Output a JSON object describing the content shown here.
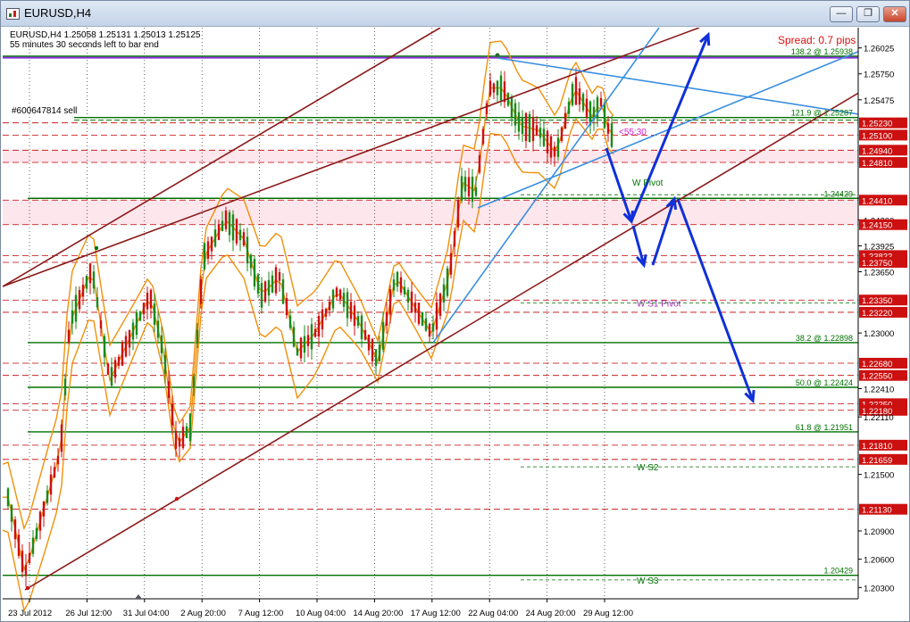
{
  "window": {
    "title": "EURUSD,H4",
    "minimize_icon": "minimize-icon",
    "restore_icon": "restore-icon",
    "close_icon": "close-icon"
  },
  "chart": {
    "symbol_info": "EURUSD,H4  1.25058 1.25131 1.25013 1.25125",
    "bar_timer": "55 minutes 30 seconds left to bar end",
    "order_label": "#600647814 sell",
    "spread": "Spread: 0.7 pips",
    "countdown": "<55:30",
    "colors": {
      "grid": "#000000",
      "resistance_red": "#c00000",
      "fib_green": "#007000",
      "channel_brown": "#8b1a1a",
      "trend_blue": "#3a8fe0",
      "projection_blue": "#1030d8",
      "bollinger": "#f0900a",
      "bull": "#1a8a1a",
      "bear": "#cc1010"
    }
  },
  "chart_data": {
    "type": "candlestick",
    "ylim": [
      1.2018,
      1.2624
    ],
    "price_ticks": [
      "1.26025",
      "1.25750",
      "1.25475",
      "1.25230",
      "1.25100",
      "1.24940",
      "1.24810",
      "1.24429",
      "1.24410",
      "1.24200",
      "1.24150",
      "1.23925",
      "1.23822",
      "1.23750",
      "1.23650",
      "1.23350",
      "1.23220",
      "1.23000",
      "1.22680",
      "1.22550",
      "1.22410",
      "1.22250",
      "1.22180",
      "1.22110",
      "1.21810",
      "1.21659",
      "1.21500",
      "1.21130",
      "1.20900",
      "1.20600",
      "1.20300"
    ],
    "price_ticks_values": [
      1.26025,
      1.2575,
      1.25475,
      1.2523,
      1.251,
      1.2494,
      1.2481,
      1.24429,
      1.2441,
      1.242,
      1.2415,
      1.23925,
      1.23822,
      1.2375,
      1.2365,
      1.2335,
      1.2322,
      1.23,
      1.2268,
      1.2255,
      1.2241,
      1.2225,
      1.2218,
      1.2211,
      1.2181,
      1.21659,
      1.215,
      1.2113,
      1.209,
      1.206,
      1.203
    ],
    "red_boxed_levels": [
      1.2523,
      1.251,
      1.2494,
      1.2481,
      1.2441,
      1.2415,
      1.23822,
      1.2375,
      1.2335,
      1.2322,
      1.2268,
      1.2255,
      1.2225,
      1.2218,
      1.2181,
      1.21659,
      1.2113
    ],
    "time_labels": [
      "23 Jul 2012",
      "26 Jul 12:00",
      "31 Jul 04:00",
      "2 Aug 20:00",
      "7 Aug 12:00",
      "10 Aug 04:00",
      "14 Aug 20:00",
      "17 Aug 12:00",
      "22 Aug 04:00",
      "24 Aug 20:00",
      "29 Aug 12:00"
    ],
    "fib_levels": [
      {
        "label": "138.2 @ 1.25938",
        "value": 1.25938
      },
      {
        "label": "121.9 @ 1.25287",
        "value": 1.25287
      },
      {
        "label": "1.24429",
        "value": 1.24429
      },
      {
        "label": "38.2 @ 1.22898",
        "value": 1.22898
      },
      {
        "label": "50.0 @ 1.22424",
        "value": 1.22424
      },
      {
        "label": "61.8 @ 1.21951",
        "value": 1.21951
      },
      {
        "label": "1.20429",
        "value": 1.20429
      }
    ],
    "pivot_labels": [
      {
        "label": "W Pivot",
        "value": 1.246
      },
      {
        "label": "W S1 Pivot",
        "value": 1.2332
      },
      {
        "label": "W S2",
        "value": 1.2158
      },
      {
        "label": "W S3",
        "value": 1.2038
      }
    ]
  }
}
